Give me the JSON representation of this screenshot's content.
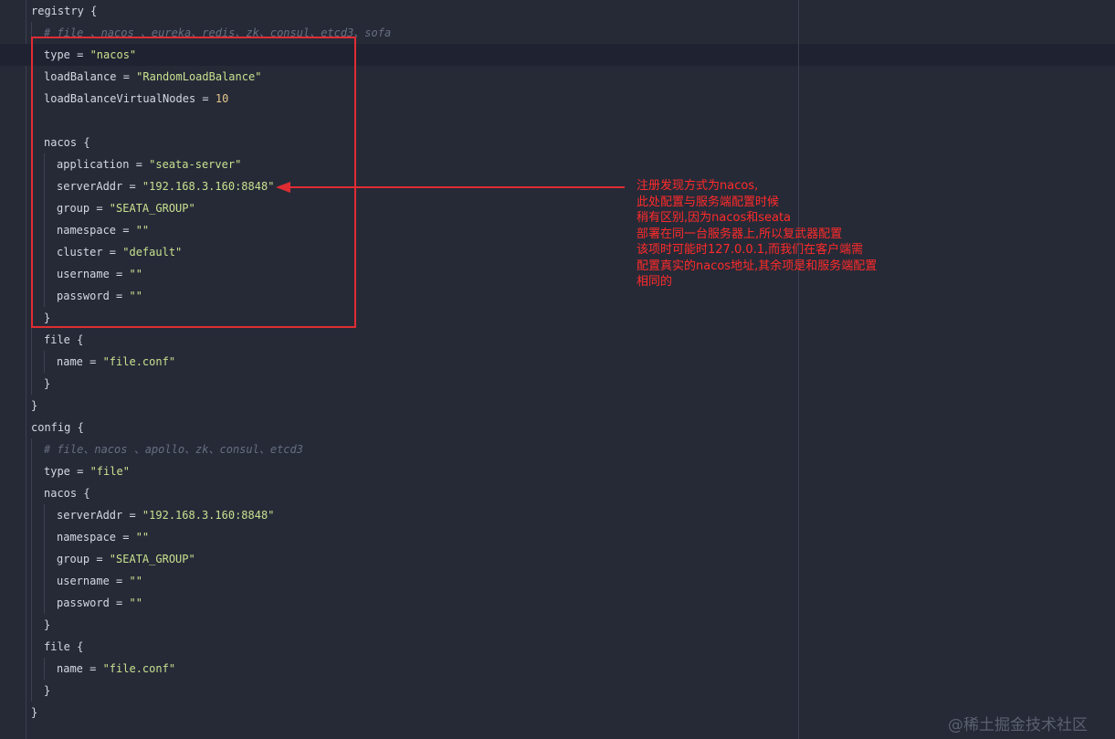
{
  "editor": {
    "lines": [
      {
        "indent": 0,
        "tokens": [
          {
            "t": "registry {",
            "c": ""
          }
        ]
      },
      {
        "indent": 1,
        "tokens": [
          {
            "t": "# file 、nacos 、eureka、redis、zk、consul、etcd3、sofa",
            "c": "cmt"
          }
        ]
      },
      {
        "indent": 1,
        "tokens": [
          {
            "t": "type = ",
            "c": ""
          },
          {
            "t": "\"nacos\"",
            "c": "str"
          }
        ]
      },
      {
        "indent": 1,
        "tokens": [
          {
            "t": "loadBalance = ",
            "c": ""
          },
          {
            "t": "\"RandomLoadBalance\"",
            "c": "str"
          }
        ]
      },
      {
        "indent": 1,
        "tokens": [
          {
            "t": "loadBalanceVirtualNodes = ",
            "c": ""
          },
          {
            "t": "10",
            "c": "num"
          }
        ]
      },
      {
        "indent": 1,
        "tokens": []
      },
      {
        "indent": 1,
        "tokens": [
          {
            "t": "nacos {",
            "c": ""
          }
        ]
      },
      {
        "indent": 2,
        "tokens": [
          {
            "t": "application = ",
            "c": ""
          },
          {
            "t": "\"seata-server\"",
            "c": "str"
          }
        ]
      },
      {
        "indent": 2,
        "tokens": [
          {
            "t": "serverAddr = ",
            "c": ""
          },
          {
            "t": "\"192.168.3.160:8848\"",
            "c": "str"
          }
        ]
      },
      {
        "indent": 2,
        "tokens": [
          {
            "t": "group = ",
            "c": ""
          },
          {
            "t": "\"SEATA_GROUP\"",
            "c": "str"
          }
        ]
      },
      {
        "indent": 2,
        "tokens": [
          {
            "t": "namespace = ",
            "c": ""
          },
          {
            "t": "\"\"",
            "c": "str"
          }
        ]
      },
      {
        "indent": 2,
        "tokens": [
          {
            "t": "cluster = ",
            "c": ""
          },
          {
            "t": "\"default\"",
            "c": "str"
          }
        ]
      },
      {
        "indent": 2,
        "tokens": [
          {
            "t": "username = ",
            "c": ""
          },
          {
            "t": "\"\"",
            "c": "str"
          }
        ]
      },
      {
        "indent": 2,
        "tokens": [
          {
            "t": "password = ",
            "c": ""
          },
          {
            "t": "\"\"",
            "c": "str"
          }
        ]
      },
      {
        "indent": 1,
        "tokens": [
          {
            "t": "}",
            "c": ""
          }
        ]
      },
      {
        "indent": 1,
        "tokens": [
          {
            "t": "file {",
            "c": ""
          }
        ]
      },
      {
        "indent": 2,
        "tokens": [
          {
            "t": "name = ",
            "c": ""
          },
          {
            "t": "\"file.conf\"",
            "c": "str"
          }
        ]
      },
      {
        "indent": 1,
        "tokens": [
          {
            "t": "}",
            "c": ""
          }
        ]
      },
      {
        "indent": 0,
        "tokens": [
          {
            "t": "}",
            "c": ""
          }
        ]
      },
      {
        "indent": 0,
        "tokens": [
          {
            "t": "config {",
            "c": ""
          }
        ]
      },
      {
        "indent": 1,
        "tokens": [
          {
            "t": "# file、nacos 、apollo、zk、consul、etcd3",
            "c": "cmt"
          }
        ]
      },
      {
        "indent": 1,
        "tokens": [
          {
            "t": "type = ",
            "c": ""
          },
          {
            "t": "\"file\"",
            "c": "str"
          }
        ]
      },
      {
        "indent": 1,
        "tokens": [
          {
            "t": "nacos {",
            "c": ""
          }
        ]
      },
      {
        "indent": 2,
        "tokens": [
          {
            "t": "serverAddr = ",
            "c": ""
          },
          {
            "t": "\"192.168.3.160:8848\"",
            "c": "str"
          }
        ]
      },
      {
        "indent": 2,
        "tokens": [
          {
            "t": "namespace = ",
            "c": ""
          },
          {
            "t": "\"\"",
            "c": "str"
          }
        ]
      },
      {
        "indent": 2,
        "tokens": [
          {
            "t": "group = ",
            "c": ""
          },
          {
            "t": "\"SEATA_GROUP\"",
            "c": "str"
          }
        ]
      },
      {
        "indent": 2,
        "tokens": [
          {
            "t": "username = ",
            "c": ""
          },
          {
            "t": "\"\"",
            "c": "str"
          }
        ]
      },
      {
        "indent": 2,
        "tokens": [
          {
            "t": "password = ",
            "c": ""
          },
          {
            "t": "\"\"",
            "c": "str"
          }
        ]
      },
      {
        "indent": 1,
        "tokens": [
          {
            "t": "}",
            "c": ""
          }
        ]
      },
      {
        "indent": 1,
        "tokens": [
          {
            "t": "file {",
            "c": ""
          }
        ]
      },
      {
        "indent": 2,
        "tokens": [
          {
            "t": "name = ",
            "c": ""
          },
          {
            "t": "\"file.conf\"",
            "c": "str"
          }
        ]
      },
      {
        "indent": 1,
        "tokens": [
          {
            "t": "}",
            "c": ""
          }
        ]
      },
      {
        "indent": 0,
        "tokens": [
          {
            "t": "}",
            "c": ""
          }
        ]
      }
    ]
  },
  "annotation": {
    "lines": [
      "注册发现方式为nacos,",
      "此处配置与服务端配置时候",
      "稍有区别,因为nacos和seata",
      "部署在同一台服务器上,所以复武器配置",
      "该项时可能时127.0.0.1,而我们在客户端需",
      "配置真实的nacos地址,其余项是和服务端配置",
      "相同的"
    ]
  },
  "colors": {
    "background": "#262a37",
    "annotation": "#ff2a2a",
    "highlight_box": "#e02c33",
    "string": "#c9e08f",
    "number": "#e3c68a",
    "comment": "#666e80"
  },
  "watermark": "@稀土掘金技术社区"
}
